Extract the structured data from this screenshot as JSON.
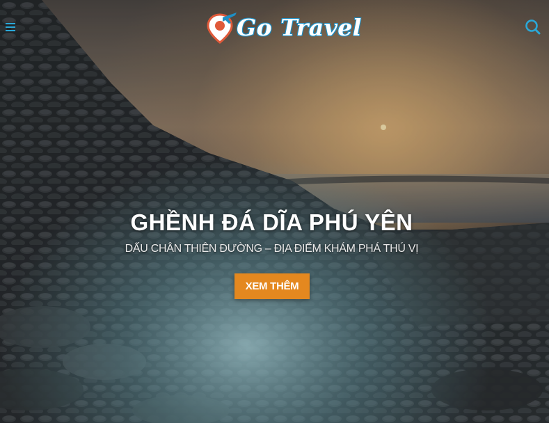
{
  "header": {
    "logo_text": "Go Travel",
    "menu_icon": "menu-icon",
    "search_icon": "search-icon",
    "accent_color": "#2aa8d8",
    "logo_pin_color": "#e05a3a"
  },
  "hero": {
    "title": "GHỀNH ĐÁ DĨA PHÚ YÊN",
    "subtitle": "DẤU CHÂN THIÊN ĐƯỜNG – ĐỊA ĐIỂM KHÁM PHÁ THÚ VỊ",
    "button_label": "XEM THÊM",
    "button_color": "#e4881f",
    "background": "sunset coast with hexagonal basalt rock columns and misty sea"
  }
}
